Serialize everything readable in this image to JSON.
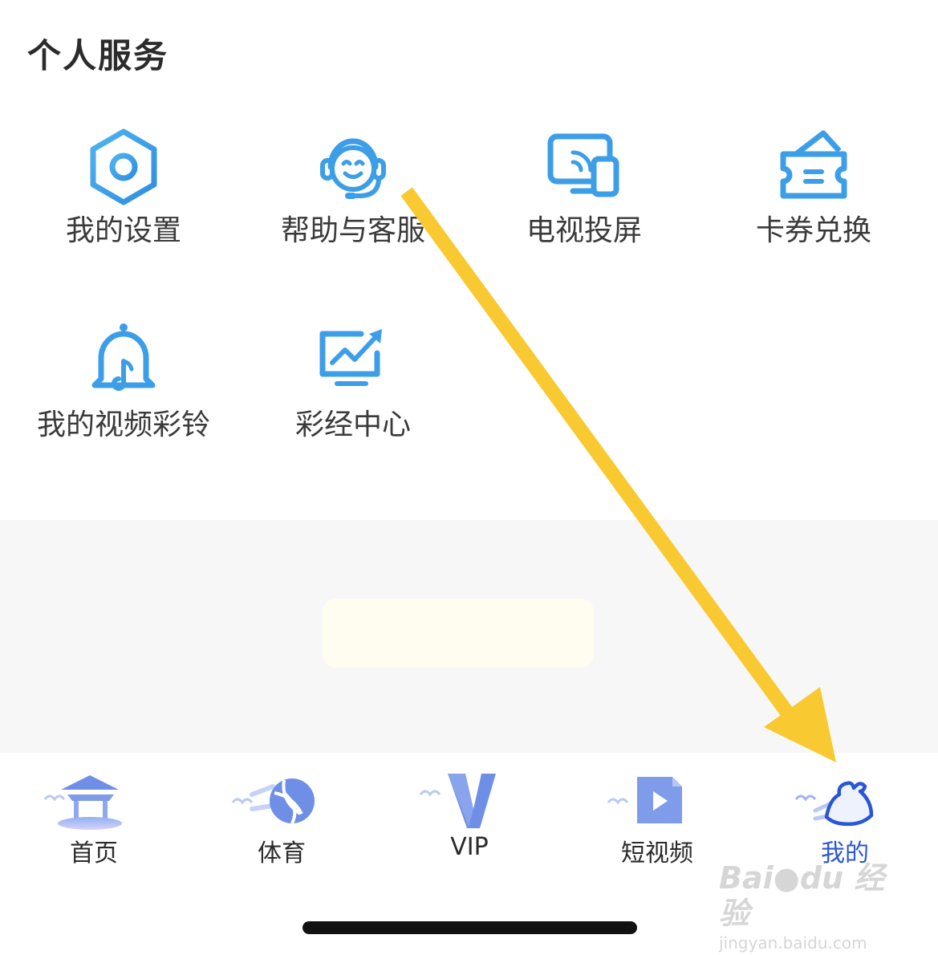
{
  "section": {
    "title": "个人服务"
  },
  "services": [
    {
      "label": "我的设置",
      "icon": "settings-hexagon-icon"
    },
    {
      "label": "帮助与客服",
      "icon": "headset-smile-icon"
    },
    {
      "label": "电视投屏",
      "icon": "screen-cast-icon"
    },
    {
      "label": "卡券兑换",
      "icon": "ticket-wallet-icon"
    },
    {
      "label": "我的视频彩铃",
      "icon": "bell-music-icon"
    },
    {
      "label": "彩经中心",
      "icon": "trend-chart-icon"
    }
  ],
  "tabbar": {
    "items": [
      {
        "label": "首页",
        "icon": "pavilion-icon"
      },
      {
        "label": "体育",
        "icon": "volleyball-icon"
      },
      {
        "label": "VIP",
        "icon": "vip-v-icon"
      },
      {
        "label": "短视频",
        "icon": "play-document-icon"
      },
      {
        "label": "我的",
        "icon": "mine-cloud-icon",
        "active": true
      }
    ]
  },
  "colors": {
    "icon_blue": "#3d9ee8",
    "active_tab": "#2a56d6",
    "arrow": "#f9c931",
    "band": "#f7f7f7"
  },
  "watermark": {
    "brand": "Bai",
    "brand2": "du",
    "cn": "经验",
    "url": "jingyan.baidu.com"
  }
}
